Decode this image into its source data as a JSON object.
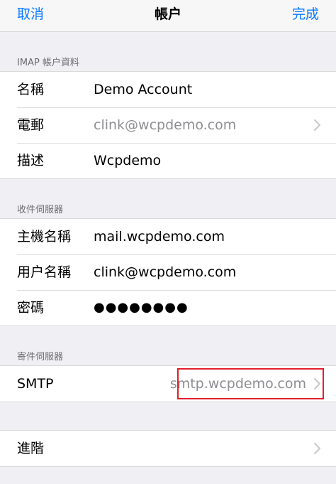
{
  "navbar": {
    "cancel_label": "取消",
    "title": "帳户",
    "done_label": "完成"
  },
  "colors": {
    "accent": "#0a7aff",
    "highlight": "#e0202a",
    "background": "#efeff4"
  },
  "imap_section": {
    "header": "IMAP 帳户資料",
    "rows": [
      {
        "label": "名稱",
        "value": "Demo Account"
      },
      {
        "label": "電郵",
        "value": "clink@wcpdemo.com"
      },
      {
        "label": "描述",
        "value": "Wcpdemo"
      }
    ]
  },
  "incoming_section": {
    "header": "收件伺服器",
    "rows": [
      {
        "label": "主機名稱",
        "value": "mail.wcpdemo.com"
      },
      {
        "label": "用户名稱",
        "value": "clink@wcpdemo.com"
      },
      {
        "label": "密碼",
        "value": "●●●●●●●●"
      }
    ]
  },
  "outgoing_section": {
    "header": "寄件伺服器",
    "smtp": {
      "label": "SMTP",
      "value": "smtp.wcpdemo.com"
    }
  },
  "advanced": {
    "label": "進階"
  },
  "icons": {
    "disclosure": "chevron-right-icon"
  }
}
